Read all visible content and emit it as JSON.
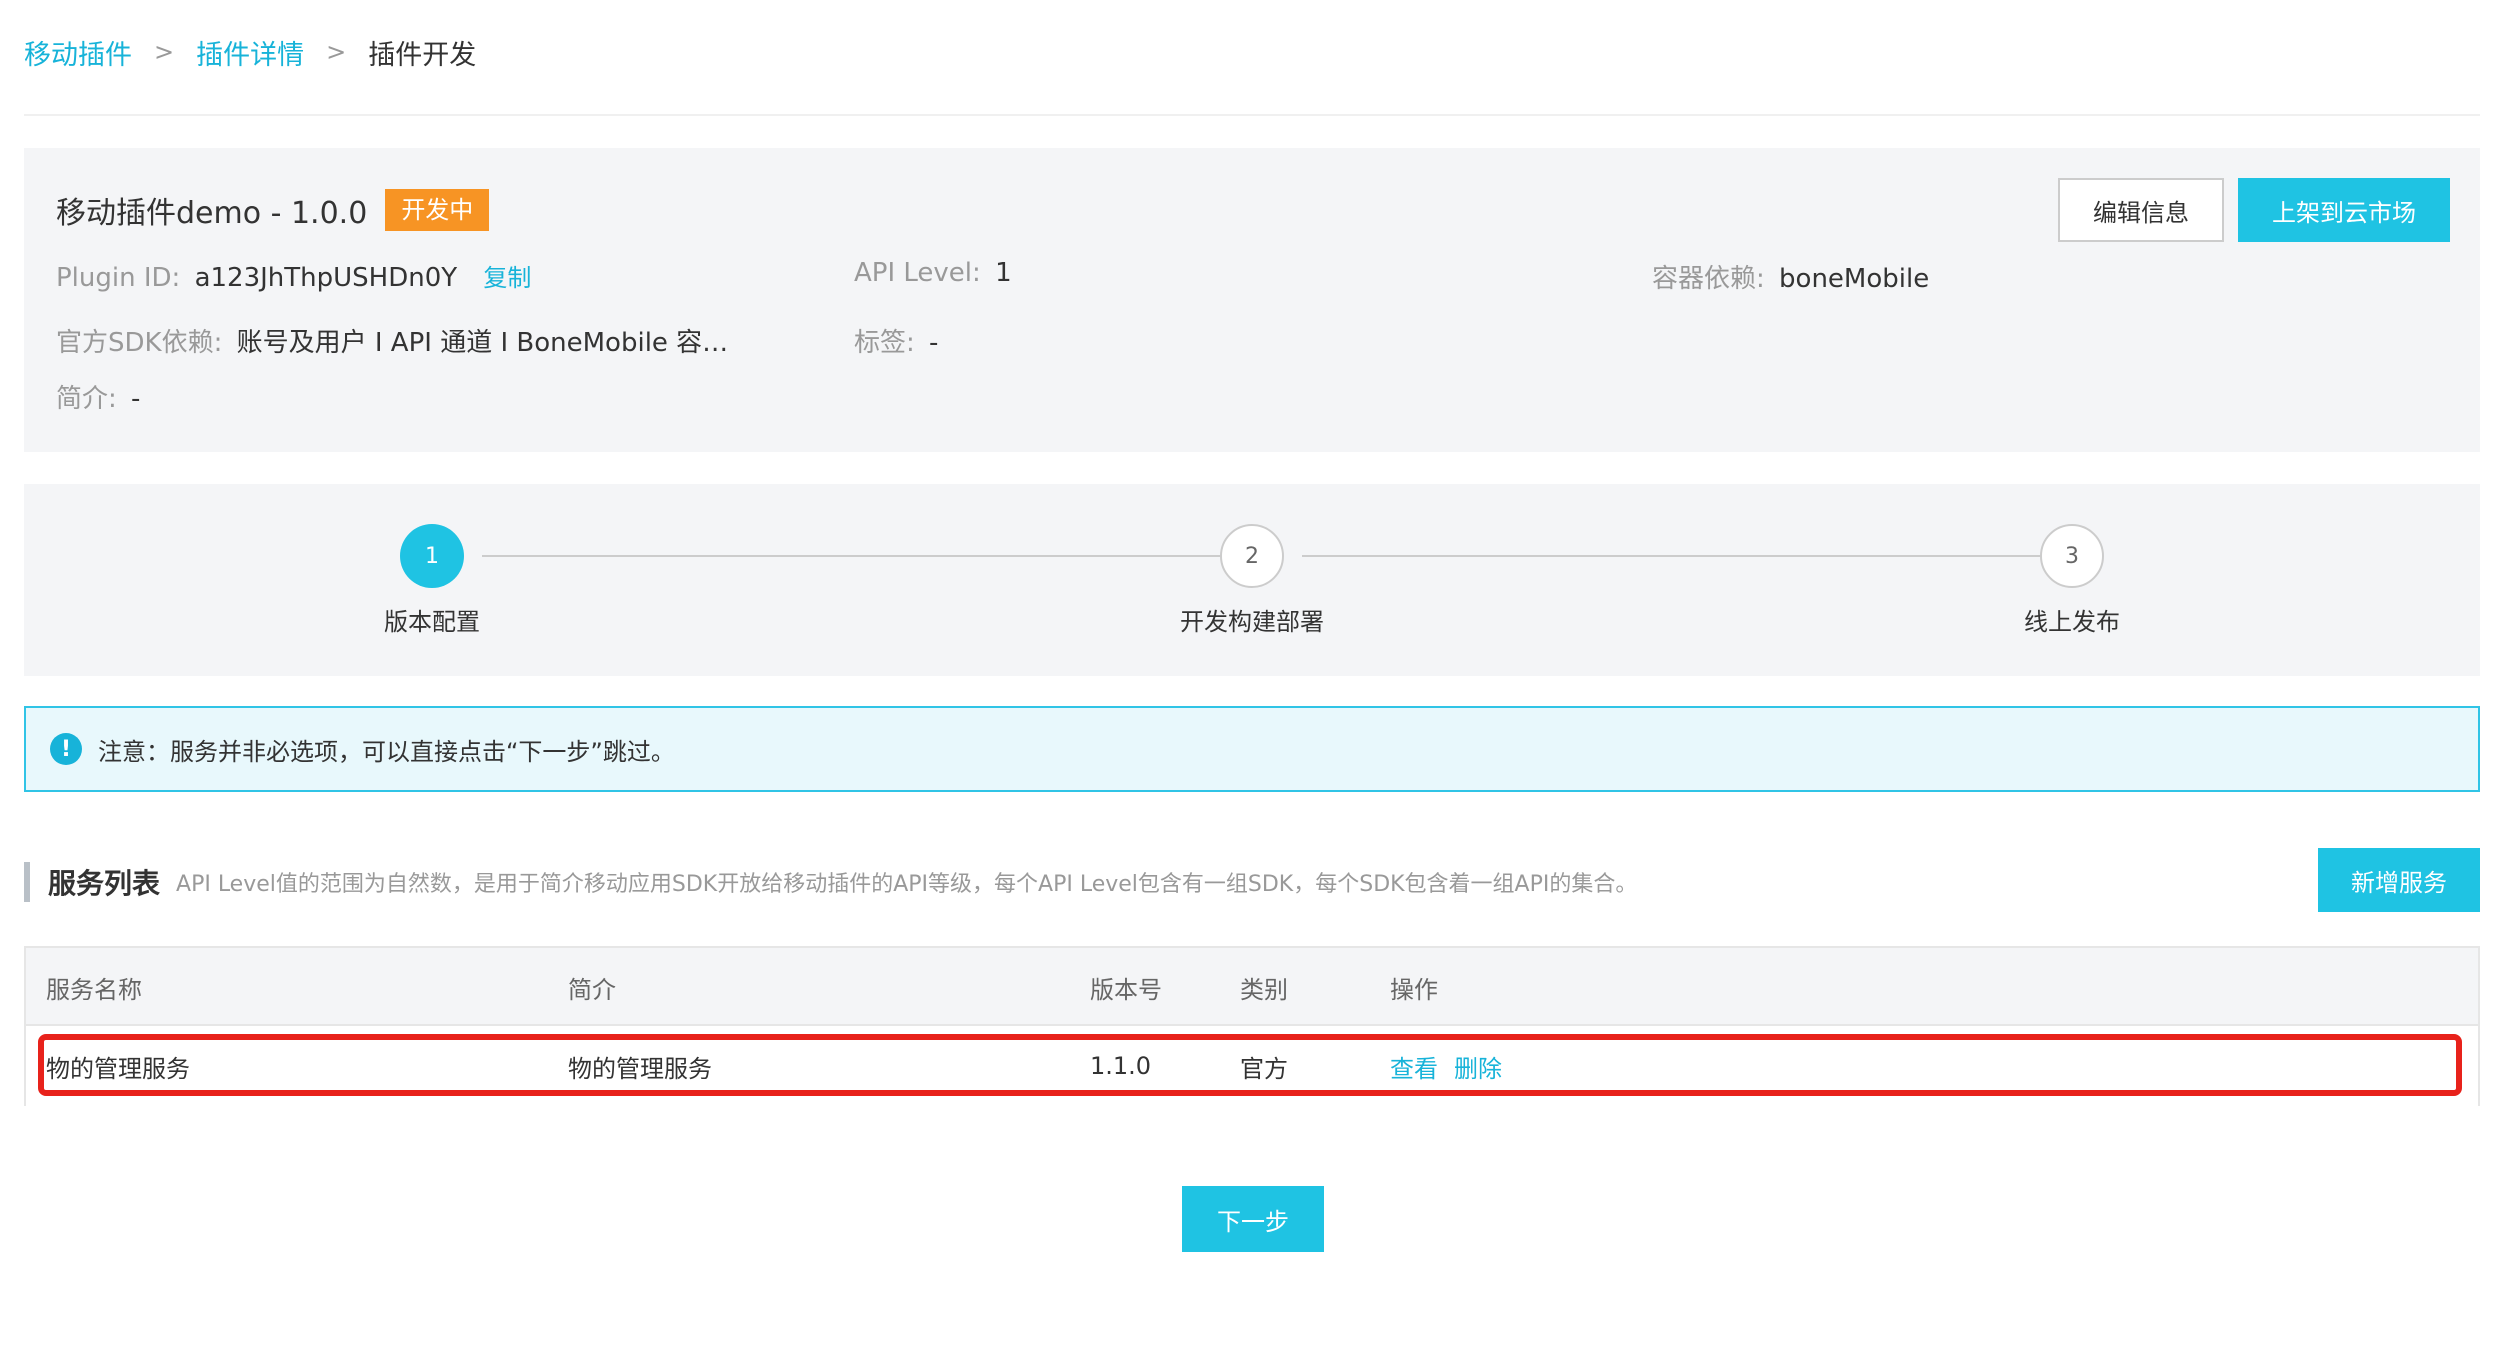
{
  "breadcrumb": {
    "items": [
      "移动插件",
      "插件详情"
    ],
    "current": "插件开发",
    "separator": ">"
  },
  "plugin": {
    "title": "移动插件demo - 1.0.0",
    "status": "开发中",
    "plugin_id_label": "Plugin ID:",
    "plugin_id_value": "a123JhThpUSHDn0Y",
    "copy_label": "复制",
    "api_level_label": "API Level:",
    "api_level_value": "1",
    "container_label": "容器依赖:",
    "container_value": "boneMobile",
    "sdk_label": "官方SDK依赖:",
    "sdk_value": "账号及用户 I API 通道 I BoneMobile 容…",
    "tag_label": "标签:",
    "tag_value": "-",
    "intro_label": "简介:",
    "intro_value": "-",
    "edit_button": "编辑信息",
    "publish_button": "上架到云市场"
  },
  "steps": [
    {
      "number": "1",
      "label": "版本配置",
      "active": true
    },
    {
      "number": "2",
      "label": "开发构建部署",
      "active": false
    },
    {
      "number": "3",
      "label": "线上发布",
      "active": false
    }
  ],
  "notice": {
    "icon": "!",
    "text": "注意：服务并非必选项，可以直接点击“下一步”跳过。"
  },
  "services": {
    "title": "服务列表",
    "description": "API Level值的范围为自然数，是用于简介移动应用SDK开放给移动插件的API等级，每个API Level包含有一组SDK，每个SDK包含着一组API的集合。",
    "add_button": "新增服务",
    "columns": [
      "服务名称",
      "简介",
      "版本号",
      "类别",
      "操作"
    ],
    "rows": [
      {
        "name": "物的管理服务",
        "intro": "物的管理服务",
        "version": "1.1.0",
        "category": "官方",
        "actions": [
          "查看",
          "删除"
        ]
      }
    ]
  },
  "next_button": "下一步",
  "colors": {
    "accent": "#1fc3e3",
    "link": "#17b3d9",
    "status_badge": "#f79424",
    "highlight": "#e8221b",
    "panel_bg": "#f4f5f7"
  }
}
